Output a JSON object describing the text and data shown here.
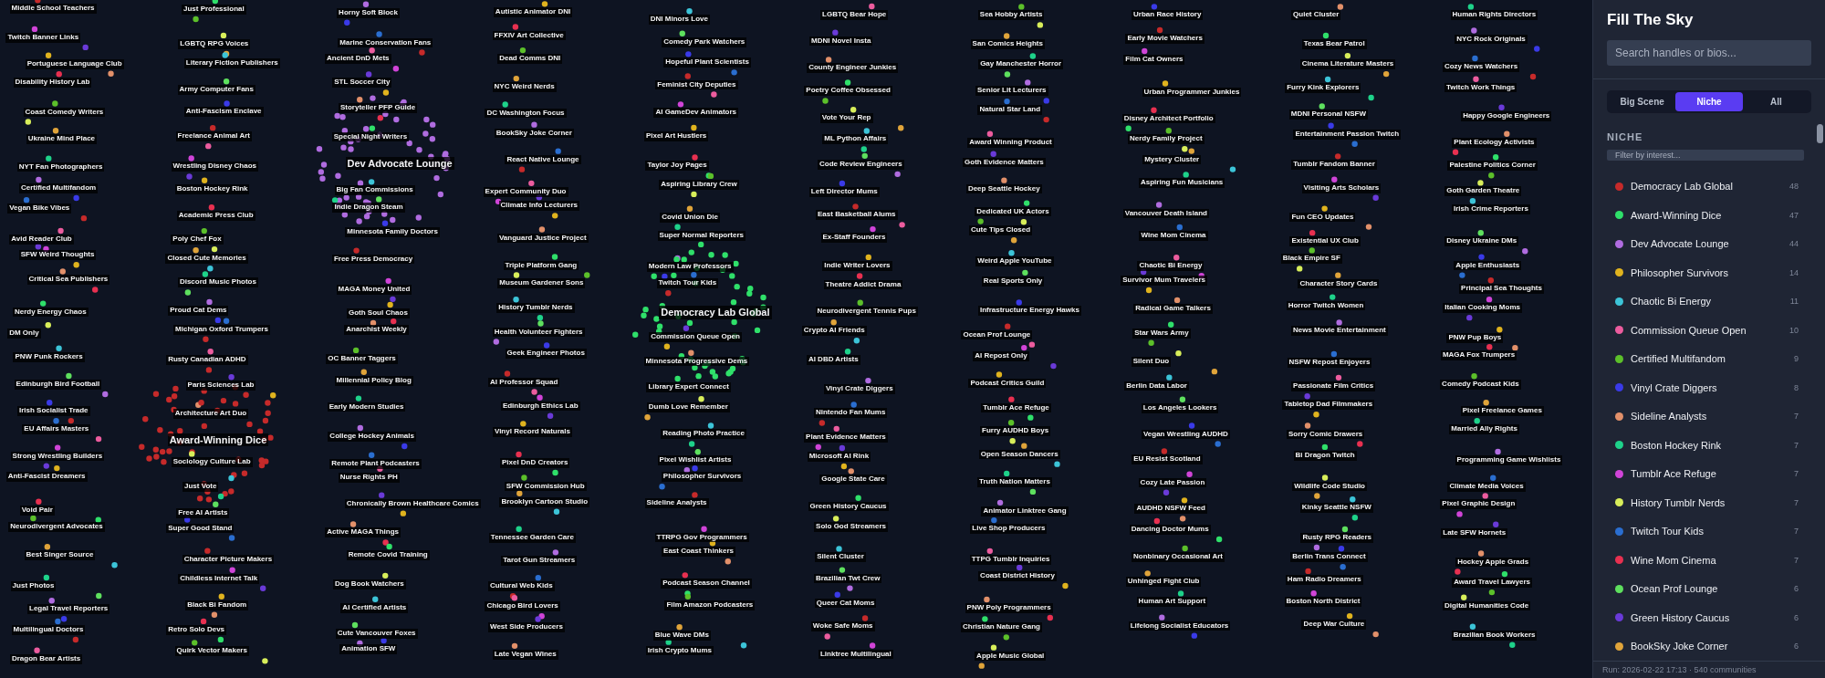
{
  "graph": {
    "node_labels": [
      {
        "text": "Middle School Teachers",
        "kind": "node"
      },
      {
        "text": "Just Professional",
        "kind": "node"
      },
      {
        "text": "Horny Soft Block",
        "kind": "node"
      },
      {
        "text": "Autistic Animator DNI",
        "kind": "node"
      },
      {
        "text": "DNI Minors Love",
        "kind": "node"
      },
      {
        "text": "LGBTQ Bear Hope",
        "kind": "node"
      },
      {
        "text": "Sea Hobby Artists",
        "kind": "node"
      },
      {
        "text": "Urban Race History",
        "kind": "node"
      },
      {
        "text": "Quiet Cluster",
        "kind": "node"
      },
      {
        "text": "Human Rights Directors",
        "kind": "node"
      },
      {
        "text": "Twitch Banner Links",
        "kind": "node"
      },
      {
        "text": "LGBTQ RPG Voices",
        "kind": "node"
      },
      {
        "text": "Marine Conservation Fans",
        "kind": "node"
      },
      {
        "text": "FFXIV Art Collective",
        "kind": "node"
      },
      {
        "text": "Comedy Park Watchers",
        "kind": "node"
      },
      {
        "text": "MDNI Novel Insta",
        "kind": "node"
      },
      {
        "text": "San Comics Heights",
        "kind": "node"
      },
      {
        "text": "Early Movie Watchers",
        "kind": "node"
      },
      {
        "text": "Texas Bear Patrol",
        "kind": "node"
      },
      {
        "text": "NYC Rock Originals",
        "kind": "node"
      },
      {
        "text": "Portuguese Language Club",
        "kind": "node"
      },
      {
        "text": "Literary Fiction Publishers",
        "kind": "node"
      },
      {
        "text": "Ancient DnD Mets",
        "kind": "node"
      },
      {
        "text": "Dead Comms DNI",
        "kind": "node"
      },
      {
        "text": "Hopeful Plant Scientists",
        "kind": "node"
      },
      {
        "text": "County Engineer Junkies",
        "kind": "node"
      },
      {
        "text": "Gay Manchester Horror",
        "kind": "node"
      },
      {
        "text": "Film Cat Owners",
        "kind": "node"
      },
      {
        "text": "Cinema Literature Masters",
        "kind": "node"
      },
      {
        "text": "Cozy News Watchers",
        "kind": "node"
      },
      {
        "text": "Disability History Lab",
        "kind": "node"
      },
      {
        "text": "Army Computer Fans",
        "kind": "node"
      },
      {
        "text": "STL Soccer City",
        "kind": "node"
      },
      {
        "text": "NYC Weird Nerds",
        "kind": "node"
      },
      {
        "text": "Feminist City Deputies",
        "kind": "node"
      },
      {
        "text": "Poetry Coffee Obsessed",
        "kind": "node"
      },
      {
        "text": "Senior Lit Lecturers",
        "kind": "node"
      },
      {
        "text": "Urban Programmer Junkies",
        "kind": "node"
      },
      {
        "text": "Furry Kink Explorers",
        "kind": "node"
      },
      {
        "text": "Twitch Work Things",
        "kind": "node"
      },
      {
        "text": "Coast Comedy Writers",
        "kind": "node"
      },
      {
        "text": "Anti-Fascism Enclave",
        "kind": "node"
      },
      {
        "text": "Storyteller PFP Guide",
        "kind": "node"
      },
      {
        "text": "DC Washington Focus",
        "kind": "node"
      },
      {
        "text": "AI GameDev Animators",
        "kind": "node"
      },
      {
        "text": "Vote Your Rep",
        "kind": "node"
      },
      {
        "text": "Natural Star Land",
        "kind": "node"
      },
      {
        "text": "Disney Architect Portfolio",
        "kind": "node"
      },
      {
        "text": "MDNI Personal NSFW",
        "kind": "node"
      },
      {
        "text": "Happy Google Engineers",
        "kind": "node"
      },
      {
        "text": "Ukraine Mind Place",
        "kind": "node"
      },
      {
        "text": "Freelance Animal Art",
        "kind": "node"
      },
      {
        "text": "Special Night Writers",
        "kind": "node"
      },
      {
        "text": "BookSky Joke Corner",
        "kind": "node"
      },
      {
        "text": "Pixel Art Hustlers",
        "kind": "node"
      },
      {
        "text": "ML Python Affairs",
        "kind": "node"
      },
      {
        "text": "Award Winning Product",
        "kind": "node"
      },
      {
        "text": "Nerdy Family Project",
        "kind": "node"
      },
      {
        "text": "Entertainment Passion Twitch",
        "kind": "node"
      },
      {
        "text": "Plant Ecology Activists",
        "kind": "node"
      },
      {
        "text": "NYT Fan Photographers",
        "kind": "node"
      },
      {
        "text": "Wrestling Disney Chaos",
        "kind": "node"
      },
      {
        "text": "Dev Advocate Lounge",
        "kind": "hub"
      },
      {
        "text": "React Native Lounge",
        "kind": "node"
      },
      {
        "text": "Taylor Joy Pages",
        "kind": "node"
      },
      {
        "text": "Code Review Engineers",
        "kind": "node"
      },
      {
        "text": "Goth Evidence Matters",
        "kind": "node"
      },
      {
        "text": "Mystery Cluster",
        "kind": "node"
      },
      {
        "text": "Tumblr Fandom Banner",
        "kind": "node"
      },
      {
        "text": "Palestine Politics Corner",
        "kind": "node"
      },
      {
        "text": "Certified Multifandom",
        "kind": "node"
      },
      {
        "text": "Boston Hockey Rink",
        "kind": "node"
      },
      {
        "text": "Big Fan Commissions",
        "kind": "node"
      },
      {
        "text": "Expert Community Duo",
        "kind": "node"
      },
      {
        "text": "Aspiring Library Crew",
        "kind": "node"
      },
      {
        "text": "Left Director Mums",
        "kind": "node"
      },
      {
        "text": "Deep Seattle Hockey",
        "kind": "node"
      },
      {
        "text": "Aspiring Fun Musicians",
        "kind": "node"
      },
      {
        "text": "Visiting Arts Scholars",
        "kind": "node"
      },
      {
        "text": "Goth Garden Theatre",
        "kind": "node"
      },
      {
        "text": "Vegan Bike Vibes",
        "kind": "node"
      },
      {
        "text": "Academic Press Club",
        "kind": "node"
      },
      {
        "text": "Indie Dragon Steam",
        "kind": "node"
      },
      {
        "text": "Climate Info Lecturers",
        "kind": "node"
      },
      {
        "text": "Covid Union Die",
        "kind": "node"
      },
      {
        "text": "East Basketball Alums",
        "kind": "node"
      },
      {
        "text": "Dedicated UK Actors",
        "kind": "node"
      },
      {
        "text": "Vancouver Death Island",
        "kind": "node"
      },
      {
        "text": "Fun CEO Updates",
        "kind": "node"
      },
      {
        "text": "Irish Crime Reporters",
        "kind": "node"
      },
      {
        "text": "Avid Reader Club",
        "kind": "node"
      },
      {
        "text": "Poly Chef Fox",
        "kind": "node"
      },
      {
        "text": "Minnesota Family Doctors",
        "kind": "node"
      },
      {
        "text": "Vanguard Justice Project",
        "kind": "node"
      },
      {
        "text": "Super Normal Reporters",
        "kind": "node"
      },
      {
        "text": "Ex-Staff Founders",
        "kind": "node"
      },
      {
        "text": "Cute Tips Closed",
        "kind": "node"
      },
      {
        "text": "Wine Mom Cinema",
        "kind": "node"
      },
      {
        "text": "Existential UX Club",
        "kind": "node"
      },
      {
        "text": "Disney Ukraine DMs",
        "kind": "node"
      },
      {
        "text": "SFW Weird Thoughts",
        "kind": "node"
      },
      {
        "text": "Closed Cute Memories",
        "kind": "node"
      },
      {
        "text": "Free Press Democracy",
        "kind": "node"
      },
      {
        "text": "Triple Platform Gang",
        "kind": "node"
      },
      {
        "text": "Modern Law Professors",
        "kind": "node"
      },
      {
        "text": "Indie Writer Lovers",
        "kind": "node"
      },
      {
        "text": "Weird Apple YouTube",
        "kind": "node"
      },
      {
        "text": "Chaotic Bi Energy",
        "kind": "node"
      },
      {
        "text": "Black Empire SF",
        "kind": "node"
      },
      {
        "text": "Apple Enthusiasts",
        "kind": "node"
      },
      {
        "text": "Critical Sea Publishers",
        "kind": "node"
      },
      {
        "text": "Discord Music Photos",
        "kind": "node"
      },
      {
        "text": "MAGA Money United",
        "kind": "node"
      },
      {
        "text": "Museum Gardener Sons",
        "kind": "node"
      },
      {
        "text": "Twitch Tour Kids",
        "kind": "node"
      },
      {
        "text": "Theatre Addict Drama",
        "kind": "node"
      },
      {
        "text": "Real Sports Only",
        "kind": "node"
      },
      {
        "text": "Survivor Mum Travelers",
        "kind": "node"
      },
      {
        "text": "Character Story Cards",
        "kind": "node"
      },
      {
        "text": "Principal Sea Thoughts",
        "kind": "node"
      },
      {
        "text": "Nerdy Energy Chaos",
        "kind": "node"
      },
      {
        "text": "Proud Cat Dems",
        "kind": "node"
      },
      {
        "text": "Goth Soul Chaos",
        "kind": "node"
      },
      {
        "text": "History Tumblr Nerds",
        "kind": "node"
      },
      {
        "text": "Democracy Lab Global",
        "kind": "hub"
      },
      {
        "text": "Neurodivergent Tennis Pups",
        "kind": "node"
      },
      {
        "text": "Infrastructure Energy Hawks",
        "kind": "node"
      },
      {
        "text": "Radical Game Talkers",
        "kind": "node"
      },
      {
        "text": "Horror Twitch Women",
        "kind": "node"
      },
      {
        "text": "Italian Cooking Moms",
        "kind": "node"
      },
      {
        "text": "DM Only",
        "kind": "node"
      },
      {
        "text": "Michigan Oxford Trumpers",
        "kind": "node"
      },
      {
        "text": "Anarchist Weekly",
        "kind": "node"
      },
      {
        "text": "Health Volunteer Fighters",
        "kind": "node"
      },
      {
        "text": "Commission Queue Open",
        "kind": "node"
      },
      {
        "text": "Crypto AI Friends",
        "kind": "node"
      },
      {
        "text": "Ocean Prof Lounge",
        "kind": "node"
      },
      {
        "text": "Star Wars Army",
        "kind": "node"
      },
      {
        "text": "News Movie Entertainment",
        "kind": "node"
      },
      {
        "text": "PNW Pup Boys",
        "kind": "node"
      },
      {
        "text": "PNW Punk Rockers",
        "kind": "node"
      },
      {
        "text": "Rusty Canadian ADHD",
        "kind": "node"
      },
      {
        "text": "OC Banner Taggers",
        "kind": "node"
      },
      {
        "text": "Geek Engineer Photos",
        "kind": "node"
      },
      {
        "text": "Minnesota Progressive Dems",
        "kind": "node"
      },
      {
        "text": "AI DBD Artists",
        "kind": "node"
      },
      {
        "text": "AI Repost Only",
        "kind": "node"
      },
      {
        "text": "Silent Duo",
        "kind": "node"
      },
      {
        "text": "NSFW Repost Enjoyers",
        "kind": "node"
      },
      {
        "text": "MAGA Fox Trumpers",
        "kind": "node"
      },
      {
        "text": "Edinburgh Bird Football",
        "kind": "node"
      },
      {
        "text": "Paris Sciences Lab",
        "kind": "node"
      },
      {
        "text": "Millennial Policy Blog",
        "kind": "node"
      },
      {
        "text": "AI Professor Squad",
        "kind": "node"
      },
      {
        "text": "Library Expert Connect",
        "kind": "node"
      },
      {
        "text": "Vinyl Crate Diggers",
        "kind": "node"
      },
      {
        "text": "Podcast Critics Guild",
        "kind": "node"
      },
      {
        "text": "Berlin Data Labor",
        "kind": "node"
      },
      {
        "text": "Passionate Film Critics",
        "kind": "node"
      },
      {
        "text": "Comedy Podcast Kids",
        "kind": "node"
      },
      {
        "text": "Irish Socialist Trade",
        "kind": "node"
      },
      {
        "text": "Architecture Art Duo",
        "kind": "node"
      },
      {
        "text": "Early Modern Studies",
        "kind": "node"
      },
      {
        "text": "Edinburgh Ethics Lab",
        "kind": "node"
      },
      {
        "text": "Dumb Love Remember",
        "kind": "node"
      },
      {
        "text": "Nintendo Fan Mums",
        "kind": "node"
      },
      {
        "text": "Tumblr Ace Refuge",
        "kind": "node"
      },
      {
        "text": "Los Angeles Lookers",
        "kind": "node"
      },
      {
        "text": "Tabletop Dad Filmmakers",
        "kind": "node"
      },
      {
        "text": "Pixel Freelance Games",
        "kind": "node"
      },
      {
        "text": "EU Affairs Masters",
        "kind": "node"
      },
      {
        "text": "Award-Winning Dice",
        "kind": "hub"
      },
      {
        "text": "College Hockey Animals",
        "kind": "node"
      },
      {
        "text": "Vinyl Record Naturals",
        "kind": "node"
      },
      {
        "text": "Reading Photo Practice",
        "kind": "node"
      },
      {
        "text": "Plant Evidence Matters",
        "kind": "node"
      },
      {
        "text": "Furry AUDHD Boys",
        "kind": "node"
      },
      {
        "text": "Vegan Wrestling AUDHD",
        "kind": "node"
      },
      {
        "text": "Sorry Comic Drawers",
        "kind": "node"
      },
      {
        "text": "Married Ally Rights",
        "kind": "node"
      },
      {
        "text": "Strong Wrestling Builders",
        "kind": "node"
      },
      {
        "text": "Sociology Culture Lab",
        "kind": "node"
      },
      {
        "text": "Remote Plant Podcasters",
        "kind": "node"
      },
      {
        "text": "Pixel DnD Creators",
        "kind": "node"
      },
      {
        "text": "Pixel Wishlist Artists",
        "kind": "node"
      },
      {
        "text": "Microsoft AI Rink",
        "kind": "node"
      },
      {
        "text": "Open Season Dancers",
        "kind": "node"
      },
      {
        "text": "EU Resist Scotland",
        "kind": "node"
      },
      {
        "text": "Bi Dragon Twitch",
        "kind": "node"
      },
      {
        "text": "Programming Game Wishlists",
        "kind": "node"
      },
      {
        "text": "Anti-Fascist Dreamers",
        "kind": "node"
      },
      {
        "text": "Just Vote",
        "kind": "node"
      },
      {
        "text": "Nurse Rights PH",
        "kind": "node"
      },
      {
        "text": "SFW Commission Hub",
        "kind": "node"
      },
      {
        "text": "Philosopher Survivors",
        "kind": "node"
      },
      {
        "text": "Google State Care",
        "kind": "node"
      },
      {
        "text": "Truth Nation Matters",
        "kind": "node"
      },
      {
        "text": "Cozy Late Passion",
        "kind": "node"
      },
      {
        "text": "Wildlife Code Studio",
        "kind": "node"
      },
      {
        "text": "Climate Media Voices",
        "kind": "node"
      },
      {
        "text": "Void Pair",
        "kind": "node"
      },
      {
        "text": "Free AI Artists",
        "kind": "node"
      },
      {
        "text": "Chronically Brown Healthcare Comics",
        "kind": "node"
      },
      {
        "text": "Brooklyn Cartoon Studio",
        "kind": "node"
      },
      {
        "text": "Sideline Analysts",
        "kind": "node"
      },
      {
        "text": "Green History Caucus",
        "kind": "node"
      },
      {
        "text": "Animator Linktree Gang",
        "kind": "node"
      },
      {
        "text": "AUDHD NSFW Feed",
        "kind": "node"
      },
      {
        "text": "Kinky Seattle NSFW",
        "kind": "node"
      },
      {
        "text": "Pixel Graphic Design",
        "kind": "node"
      },
      {
        "text": "Neurodivergent Advocates",
        "kind": "node"
      },
      {
        "text": "Super Good Stand",
        "kind": "node"
      },
      {
        "text": "Active MAGA Things",
        "kind": "node"
      },
      {
        "text": "Tennessee Garden Care",
        "kind": "node"
      },
      {
        "text": "TTRPG Gov Programmers",
        "kind": "node"
      },
      {
        "text": "Solo God Streamers",
        "kind": "node"
      },
      {
        "text": "Live Shop Producers",
        "kind": "node"
      },
      {
        "text": "Dancing Doctor Mums",
        "kind": "node"
      },
      {
        "text": "Rusty RPG Readers",
        "kind": "node"
      },
      {
        "text": "Late SFW Hornets",
        "kind": "node"
      },
      {
        "text": "Best Singer Source",
        "kind": "node"
      },
      {
        "text": "Character Picture Makers",
        "kind": "node"
      },
      {
        "text": "Remote Covid Training",
        "kind": "node"
      },
      {
        "text": "Tarot Gun Streamers",
        "kind": "node"
      },
      {
        "text": "East Coast Thinkers",
        "kind": "node"
      },
      {
        "text": "Silent Cluster",
        "kind": "node"
      },
      {
        "text": "TTPG Tumblr Inquiries",
        "kind": "node"
      },
      {
        "text": "Nonbinary Occasional Art",
        "kind": "node"
      },
      {
        "text": "Berlin Trans Connect",
        "kind": "node"
      },
      {
        "text": "Hockey Apple Grads",
        "kind": "node"
      },
      {
        "text": "Just Photos",
        "kind": "node"
      },
      {
        "text": "Childless Internet Talk",
        "kind": "node"
      },
      {
        "text": "Dog Book Watchers",
        "kind": "node"
      },
      {
        "text": "Cultural Web Kids",
        "kind": "node"
      },
      {
        "text": "Podcast Season Channel",
        "kind": "node"
      },
      {
        "text": "Brazilian Twt Crew",
        "kind": "node"
      },
      {
        "text": "Coast District History",
        "kind": "node"
      },
      {
        "text": "Unhinged Fight Club",
        "kind": "node"
      },
      {
        "text": "Ham Radio Dreamers",
        "kind": "node"
      },
      {
        "text": "Award Travel Lawyers",
        "kind": "node"
      },
      {
        "text": "Legal Travel Reporters",
        "kind": "node"
      },
      {
        "text": "Black Bi Fandom",
        "kind": "node"
      },
      {
        "text": "AI Certified Artists",
        "kind": "node"
      },
      {
        "text": "Chicago Bird Lovers",
        "kind": "node"
      },
      {
        "text": "Film Amazon Podcasters",
        "kind": "node"
      },
      {
        "text": "Queer Cat Moms",
        "kind": "node"
      },
      {
        "text": "PNW Poly Programmers",
        "kind": "node"
      },
      {
        "text": "Human Art Support",
        "kind": "node"
      },
      {
        "text": "Boston North District",
        "kind": "node"
      },
      {
        "text": "Digital Humanities Code",
        "kind": "node"
      },
      {
        "text": "Multilingual Doctors",
        "kind": "node"
      },
      {
        "text": "Retro Solo Devs",
        "kind": "node"
      },
      {
        "text": "Cute Vancouver Foxes",
        "kind": "node"
      },
      {
        "text": "West Side Producers",
        "kind": "node"
      },
      {
        "text": "Blue Wave DMs",
        "kind": "node"
      },
      {
        "text": "Woke Safe Moms",
        "kind": "node"
      },
      {
        "text": "Christian Nature Gang",
        "kind": "node"
      },
      {
        "text": "Lifelong Socialist Educators",
        "kind": "node"
      },
      {
        "text": "Deep War Culture",
        "kind": "node"
      },
      {
        "text": "Brazilian Book Workers",
        "kind": "node"
      },
      {
        "text": "Dragon Bear Artists",
        "kind": "node"
      },
      {
        "text": "Quirk Vector Makers",
        "kind": "node"
      },
      {
        "text": "Animation SFW",
        "kind": "node"
      },
      {
        "text": "Late Vegan Wines",
        "kind": "node"
      },
      {
        "text": "Irish Crypto Mums",
        "kind": "node"
      },
      {
        "text": "Linktree Multilingual",
        "kind": "node"
      },
      {
        "text": "Apple Music Global",
        "kind": "node"
      }
    ]
  },
  "sidebar": {
    "title": "Fill The Sky",
    "search": {
      "placeholder": "Search handles or bios..."
    },
    "tabs": [
      {
        "label": "Big Scene",
        "selected": false
      },
      {
        "label": "Niche",
        "selected": true
      },
      {
        "label": "All",
        "selected": false
      }
    ],
    "section": "NICHE",
    "filter": {
      "placeholder": "Filter by interest..."
    },
    "communities": [
      {
        "name": "Democracy Lab Global",
        "count": "48",
        "color": "#c62a2a"
      },
      {
        "name": "Award-Winning Dice",
        "count": "47",
        "color": "#2fe06a"
      },
      {
        "name": "Dev Advocate Lounge",
        "count": "44",
        "color": "#b06ce0"
      },
      {
        "name": "Philosopher Survivors",
        "count": "14",
        "color": "#e0b31e"
      },
      {
        "name": "Chaotic Bi Energy",
        "count": "11",
        "color": "#3cc4d8"
      },
      {
        "name": "Commission Queue Open",
        "count": "10",
        "color": "#ec5c9e"
      },
      {
        "name": "Certified Multifandom",
        "count": "9",
        "color": "#5cc02a"
      },
      {
        "name": "Vinyl Crate Diggers",
        "count": "8",
        "color": "#3a3ae8"
      },
      {
        "name": "Sideline Analysts",
        "count": "7",
        "color": "#e2906a"
      },
      {
        "name": "Boston Hockey Rink",
        "count": "7",
        "color": "#1ed28a"
      },
      {
        "name": "Tumblr Ace Refuge",
        "count": "7",
        "color": "#d044d8"
      },
      {
        "name": "History Tumblr Nerds",
        "count": "7",
        "color": "#d8ee5a"
      },
      {
        "name": "Twitch Tour Kids",
        "count": "7",
        "color": "#2a6ed0"
      },
      {
        "name": "Wine Mom Cinema",
        "count": "7",
        "color": "#e83050"
      },
      {
        "name": "Ocean Prof Lounge",
        "count": "6",
        "color": "#5ee05e"
      },
      {
        "name": "Green History Caucus",
        "count": "6",
        "color": "#6a3ad8"
      },
      {
        "name": "BookSky Joke Corner",
        "count": "6",
        "color": "#e0a43a"
      }
    ],
    "footer": "Run: 2026-02-22 17:13 · 540 communities"
  }
}
